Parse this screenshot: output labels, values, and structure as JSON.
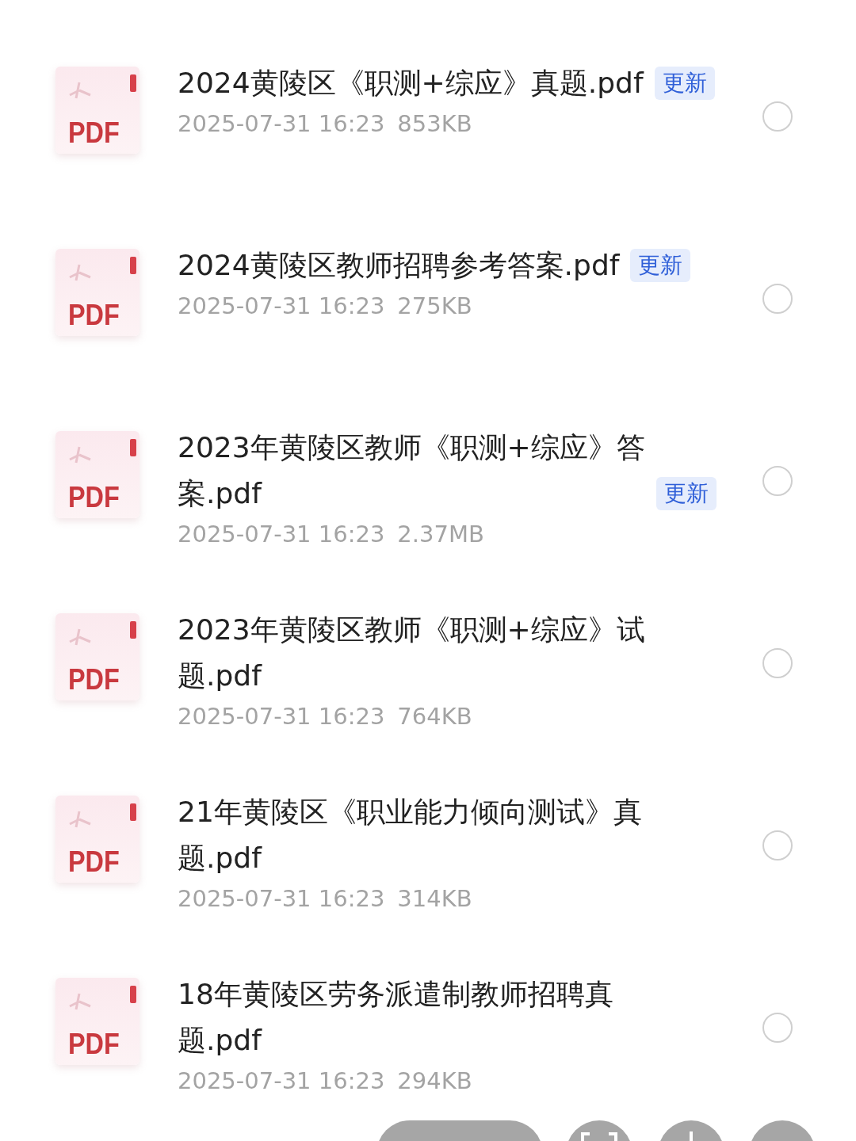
{
  "files": [
    {
      "icon_label": "PDF",
      "title": "2024黄陵区《职测+综应》真题.pdf",
      "badge": "更新",
      "time": "2025-07-31 16:23",
      "size": "853KB",
      "selected": false
    },
    {
      "icon_label": "PDF",
      "title": "2024黄陵区教师招聘参考答案.pdf",
      "badge": "更新",
      "time": "2025-07-31 16:23",
      "size": "275KB",
      "selected": false
    },
    {
      "icon_label": "PDF",
      "title": "2023年黄陵区教师《职测+综应》答案.pdf",
      "badge": "更新",
      "time": "2025-07-31 16:23",
      "size": "2.37MB",
      "selected": false
    },
    {
      "icon_label": "PDF",
      "title": "2023年黄陵区教师《职测+综应》试题.pdf",
      "time": "2025-07-31 16:23",
      "size": "764KB",
      "selected": false
    },
    {
      "icon_label": "PDF",
      "title": "21年黄陵区《职业能力倾向测试》真题.pdf",
      "time": "2025-07-31 16:23",
      "size": "314KB",
      "selected": false
    },
    {
      "icon_label": "PDF",
      "title": "18年黄陵区劳务派遣制教师招聘真题.pdf",
      "time": "2025-07-31 16:23",
      "size": "294KB",
      "selected": false
    }
  ]
}
